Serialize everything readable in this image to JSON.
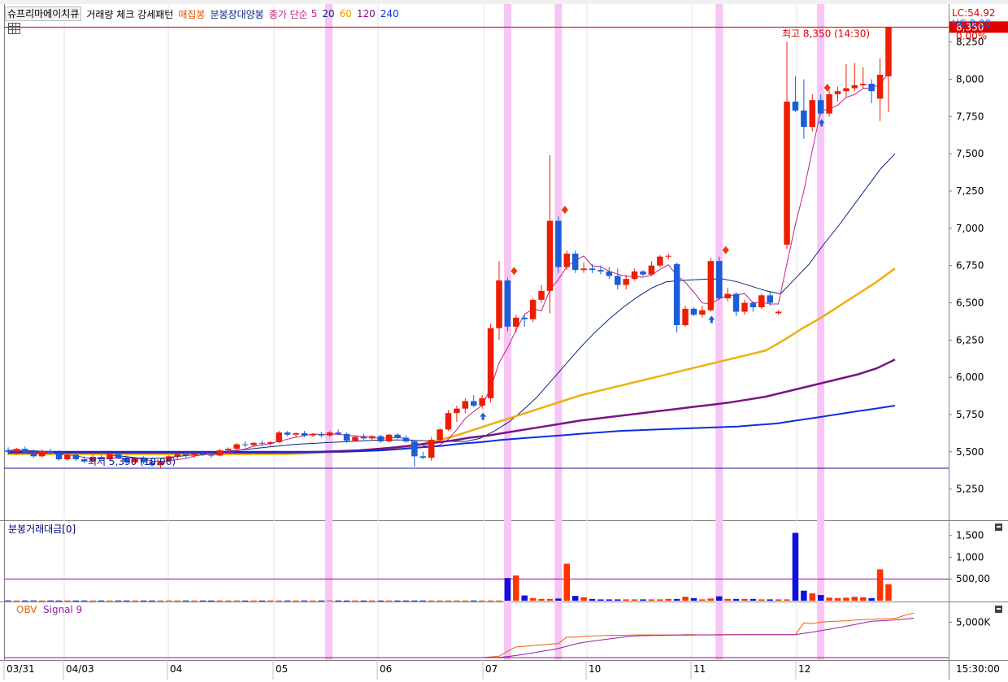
{
  "legend": {
    "title": "슈프리마에이치큐",
    "pattern": "거래량 체크 강세패턴",
    "accum": "매집봉",
    "minute_bull": "분봉장대양봉",
    "ma_label": "종가 단순",
    "ma_periods": [
      "5",
      "20",
      "60",
      "120",
      "240"
    ]
  },
  "header_right": {
    "lc": "LC:54.92",
    "hc": "HC:0.00"
  },
  "price_axis": {
    "ticks": [
      "8,250",
      "8,000",
      "7,750",
      "7,500",
      "7,250",
      "7,000",
      "6,750",
      "6,500",
      "6,250",
      "6,000",
      "5,750",
      "5,500",
      "5,250"
    ]
  },
  "annotations": {
    "high": "최고 8,350 (14:30)",
    "low": "최저 5,390 (10:06)",
    "last_price": "8,350",
    "last_change": "0.00%"
  },
  "volume_panel": {
    "label": "분봉거래대금[0]",
    "ticks": [
      "1,500",
      "1,000",
      "500,00"
    ]
  },
  "obv_panel": {
    "obv": "OBV",
    "signal": "Signal 9",
    "ticks": [
      "5,000K"
    ]
  },
  "x_axis": {
    "labels": [
      "03/31",
      "04/03",
      "04",
      "05",
      "06",
      "07",
      "10",
      "11",
      "12"
    ],
    "end_time": "15:30:00"
  },
  "colors": {
    "up": "#ee1c00",
    "down": "#1a5ed8",
    "ma5": "#c41e8f",
    "ma20": "#0a2680",
    "ma60": "#f0ae0e",
    "ma120": "#7a1484",
    "ma240": "#0a2ee0",
    "highline": "#e00000",
    "lowline": "#1a1a9a",
    "highlight": "#f7c6f5",
    "obv": "#f06000",
    "signal": "#9a1ca8"
  },
  "chart_data": {
    "type": "candlestick",
    "title": "슈프리마에이치큐",
    "ylim": [
      5150,
      8450
    ],
    "high": 8350,
    "low": 5390,
    "candles": [
      {
        "o": 5510,
        "h": 5530,
        "l": 5480,
        "c": 5500
      },
      {
        "o": 5500,
        "h": 5525,
        "l": 5480,
        "c": 5520
      },
      {
        "o": 5520,
        "h": 5535,
        "l": 5490,
        "c": 5495
      },
      {
        "o": 5495,
        "h": 5515,
        "l": 5460,
        "c": 5470
      },
      {
        "o": 5470,
        "h": 5515,
        "l": 5460,
        "c": 5505
      },
      {
        "o": 5505,
        "h": 5520,
        "l": 5485,
        "c": 5490
      },
      {
        "o": 5490,
        "h": 5510,
        "l": 5440,
        "c": 5450
      },
      {
        "o": 5450,
        "h": 5490,
        "l": 5440,
        "c": 5480
      },
      {
        "o": 5480,
        "h": 5495,
        "l": 5440,
        "c": 5450
      },
      {
        "o": 5450,
        "h": 5470,
        "l": 5425,
        "c": 5435
      },
      {
        "o": 5435,
        "h": 5480,
        "l": 5430,
        "c": 5465
      },
      {
        "o": 5465,
        "h": 5480,
        "l": 5440,
        "c": 5450
      },
      {
        "o": 5450,
        "h": 5490,
        "l": 5440,
        "c": 5485
      },
      {
        "o": 5485,
        "h": 5495,
        "l": 5450,
        "c": 5460
      },
      {
        "o": 5460,
        "h": 5475,
        "l": 5420,
        "c": 5430
      },
      {
        "o": 5430,
        "h": 5460,
        "l": 5420,
        "c": 5455
      },
      {
        "o": 5455,
        "h": 5470,
        "l": 5420,
        "c": 5430
      },
      {
        "o": 5430,
        "h": 5445,
        "l": 5400,
        "c": 5410
      },
      {
        "o": 5410,
        "h": 5450,
        "l": 5390,
        "c": 5440
      },
      {
        "o": 5440,
        "h": 5475,
        "l": 5430,
        "c": 5470
      },
      {
        "o": 5470,
        "h": 5490,
        "l": 5450,
        "c": 5485
      },
      {
        "o": 5485,
        "h": 5500,
        "l": 5460,
        "c": 5475
      },
      {
        "o": 5475,
        "h": 5495,
        "l": 5460,
        "c": 5490
      },
      {
        "o": 5490,
        "h": 5505,
        "l": 5470,
        "c": 5480
      },
      {
        "o": 5480,
        "h": 5500,
        "l": 5460,
        "c": 5475
      },
      {
        "o": 5475,
        "h": 5520,
        "l": 5470,
        "c": 5510
      },
      {
        "o": 5510,
        "h": 5530,
        "l": 5490,
        "c": 5520
      },
      {
        "o": 5520,
        "h": 5560,
        "l": 5510,
        "c": 5550
      },
      {
        "o": 5550,
        "h": 5570,
        "l": 5530,
        "c": 5545
      },
      {
        "o": 5545,
        "h": 5565,
        "l": 5535,
        "c": 5560
      },
      {
        "o": 5560,
        "h": 5575,
        "l": 5540,
        "c": 5555
      },
      {
        "o": 5555,
        "h": 5570,
        "l": 5540,
        "c": 5565
      },
      {
        "o": 5565,
        "h": 5640,
        "l": 5560,
        "c": 5630
      },
      {
        "o": 5630,
        "h": 5640,
        "l": 5605,
        "c": 5615
      },
      {
        "o": 5615,
        "h": 5630,
        "l": 5595,
        "c": 5625
      },
      {
        "o": 5625,
        "h": 5640,
        "l": 5600,
        "c": 5610
      },
      {
        "o": 5610,
        "h": 5625,
        "l": 5600,
        "c": 5620
      },
      {
        "o": 5620,
        "h": 5635,
        "l": 5595,
        "c": 5610
      },
      {
        "o": 5610,
        "h": 5640,
        "l": 5600,
        "c": 5630
      },
      {
        "o": 5630,
        "h": 5650,
        "l": 5610,
        "c": 5620
      },
      {
        "o": 5620,
        "h": 5630,
        "l": 5560,
        "c": 5575
      },
      {
        "o": 5575,
        "h": 5610,
        "l": 5570,
        "c": 5600
      },
      {
        "o": 5600,
        "h": 5620,
        "l": 5580,
        "c": 5590
      },
      {
        "o": 5590,
        "h": 5610,
        "l": 5580,
        "c": 5605
      },
      {
        "o": 5605,
        "h": 5615,
        "l": 5560,
        "c": 5570
      },
      {
        "o": 5570,
        "h": 5620,
        "l": 5565,
        "c": 5615
      },
      {
        "o": 5615,
        "h": 5625,
        "l": 5585,
        "c": 5595
      },
      {
        "o": 5595,
        "h": 5610,
        "l": 5560,
        "c": 5570
      },
      {
        "o": 5570,
        "h": 5580,
        "l": 5400,
        "c": 5470
      },
      {
        "o": 5470,
        "h": 5500,
        "l": 5450,
        "c": 5460
      },
      {
        "o": 5460,
        "h": 5600,
        "l": 5440,
        "c": 5580
      },
      {
        "o": 5580,
        "h": 5660,
        "l": 5570,
        "c": 5650
      },
      {
        "o": 5650,
        "h": 5780,
        "l": 5640,
        "c": 5760
      },
      {
        "o": 5760,
        "h": 5810,
        "l": 5700,
        "c": 5790
      },
      {
        "o": 5790,
        "h": 5860,
        "l": 5760,
        "c": 5840
      },
      {
        "o": 5840,
        "h": 5880,
        "l": 5800,
        "c": 5810
      },
      {
        "o": 5810,
        "h": 5880,
        "l": 5790,
        "c": 5860
      },
      {
        "o": 5860,
        "h": 6360,
        "l": 5830,
        "c": 6330
      },
      {
        "o": 6330,
        "h": 6780,
        "l": 6250,
        "c": 6650
      },
      {
        "o": 6650,
        "h": 6670,
        "l": 6310,
        "c": 6340
      },
      {
        "o": 6340,
        "h": 6420,
        "l": 6300,
        "c": 6400
      },
      {
        "o": 6400,
        "h": 6420,
        "l": 6340,
        "c": 6390
      },
      {
        "o": 6390,
        "h": 6530,
        "l": 6370,
        "c": 6520
      },
      {
        "o": 6520,
        "h": 6620,
        "l": 6500,
        "c": 6580
      },
      {
        "o": 6580,
        "h": 7490,
        "l": 6430,
        "c": 7050
      },
      {
        "o": 7050,
        "h": 7080,
        "l": 6700,
        "c": 6740
      },
      {
        "o": 6740,
        "h": 6850,
        "l": 6720,
        "c": 6830
      },
      {
        "o": 6830,
        "h": 6850,
        "l": 6700,
        "c": 6720
      },
      {
        "o": 6720,
        "h": 6770,
        "l": 6700,
        "c": 6730
      },
      {
        "o": 6730,
        "h": 6760,
        "l": 6700,
        "c": 6720
      },
      {
        "o": 6720,
        "h": 6750,
        "l": 6690,
        "c": 6710
      },
      {
        "o": 6710,
        "h": 6740,
        "l": 6660,
        "c": 6680
      },
      {
        "o": 6680,
        "h": 6730,
        "l": 6590,
        "c": 6620
      },
      {
        "o": 6620,
        "h": 6690,
        "l": 6590,
        "c": 6660
      },
      {
        "o": 6660,
        "h": 6730,
        "l": 6650,
        "c": 6710
      },
      {
        "o": 6710,
        "h": 6720,
        "l": 6680,
        "c": 6690
      },
      {
        "o": 6690,
        "h": 6780,
        "l": 6680,
        "c": 6750
      },
      {
        "o": 6750,
        "h": 6820,
        "l": 6740,
        "c": 6810
      },
      {
        "o": 6810,
        "h": 6830,
        "l": 6790,
        "c": 6815
      },
      {
        "o": 6760,
        "h": 6770,
        "l": 6300,
        "c": 6350
      },
      {
        "o": 6350,
        "h": 6480,
        "l": 6340,
        "c": 6460
      },
      {
        "o": 6460,
        "h": 6470,
        "l": 6410,
        "c": 6420
      },
      {
        "o": 6420,
        "h": 6480,
        "l": 6400,
        "c": 6450
      },
      {
        "o": 6450,
        "h": 6800,
        "l": 6440,
        "c": 6780
      },
      {
        "o": 6780,
        "h": 6810,
        "l": 6520,
        "c": 6530
      },
      {
        "o": 6530,
        "h": 6600,
        "l": 6510,
        "c": 6560
      },
      {
        "o": 6560,
        "h": 6570,
        "l": 6410,
        "c": 6440
      },
      {
        "o": 6440,
        "h": 6520,
        "l": 6420,
        "c": 6500
      },
      {
        "o": 6500,
        "h": 6510,
        "l": 6440,
        "c": 6470
      },
      {
        "o": 6470,
        "h": 6560,
        "l": 6460,
        "c": 6550
      },
      {
        "o": 6550,
        "h": 6580,
        "l": 6480,
        "c": 6500
      },
      {
        "o": 6430,
        "h": 6450,
        "l": 6420,
        "c": 6440
      },
      {
        "o": 6890,
        "h": 8250,
        "l": 6860,
        "c": 7850
      },
      {
        "o": 7850,
        "h": 8020,
        "l": 7780,
        "c": 7790
      },
      {
        "o": 7790,
        "h": 8000,
        "l": 7600,
        "c": 7680
      },
      {
        "o": 7680,
        "h": 7900,
        "l": 7650,
        "c": 7860
      },
      {
        "o": 7860,
        "h": 7900,
        "l": 7760,
        "c": 7770
      },
      {
        "o": 7770,
        "h": 7930,
        "l": 7750,
        "c": 7900
      },
      {
        "o": 7900,
        "h": 7950,
        "l": 7850,
        "c": 7920
      },
      {
        "o": 7920,
        "h": 8100,
        "l": 7880,
        "c": 7940
      },
      {
        "o": 7940,
        "h": 8110,
        "l": 7920,
        "c": 7960
      },
      {
        "o": 7960,
        "h": 8080,
        "l": 7940,
        "c": 7970
      },
      {
        "o": 7970,
        "h": 8000,
        "l": 7840,
        "c": 7920
      },
      {
        "o": 7870,
        "h": 8140,
        "l": 7720,
        "c": 8030
      },
      {
        "o": 8020,
        "h": 8350,
        "l": 7780,
        "c": 8350
      }
    ],
    "pattern_markers": [
      59,
      65,
      84,
      96
    ],
    "bull_markers": [
      59,
      65,
      84,
      96
    ],
    "minute_bull_markers": [
      56,
      83,
      96
    ],
    "ma": [
      {
        "period": 20,
        "values": [
          5510,
          5510,
          5505,
          5500,
          5495,
          5490,
          5485,
          5480,
          5470,
          5460,
          5455,
          5460,
          5470,
          5480,
          5490,
          5500,
          5510,
          5520,
          5530,
          5540,
          5550,
          5555,
          5560,
          5565,
          5570,
          5575,
          5580,
          5580,
          5580,
          5575,
          5570,
          5570,
          5570,
          5590,
          5640,
          5700,
          5780,
          5870,
          5980,
          6090,
          6200,
          6300,
          6390,
          6470,
          6540,
          6600,
          6640,
          6650,
          6655,
          6660,
          6660,
          6640,
          6610,
          6580,
          6560,
          6660,
          6760,
          6890,
          7010,
          7140,
          7270,
          7400,
          7500
        ]
      },
      {
        "period": 60,
        "values": [
          5485,
          5485,
          5485,
          5485,
          5485,
          5485,
          5485,
          5485,
          5485,
          5485,
          5485,
          5485,
          5485,
          5485,
          5485,
          5485,
          5490,
          5495,
          5500,
          5505,
          5510,
          5520,
          5540,
          5570,
          5600,
          5640,
          5680,
          5720,
          5760,
          5800,
          5840,
          5880,
          5910,
          5940,
          5970,
          6000,
          6030,
          6060,
          6090,
          6120,
          6150,
          6180,
          6250,
          6330,
          6400,
          6480,
          6560,
          6640,
          6730
        ]
      },
      {
        "period": 120,
        "values": [
          5495,
          5495,
          5495,
          5495,
          5495,
          5495,
          5495,
          5495,
          5495,
          5495,
          5495,
          5495,
          5495,
          5495,
          5495,
          5495,
          5497,
          5500,
          5505,
          5510,
          5520,
          5530,
          5545,
          5560,
          5575,
          5595,
          5610,
          5630,
          5650,
          5670,
          5690,
          5710,
          5725,
          5740,
          5755,
          5770,
          5785,
          5800,
          5815,
          5830,
          5850,
          5870,
          5900,
          5930,
          5960,
          5990,
          6020,
          6060,
          6120
        ]
      },
      {
        "period": 240,
        "values": [
          5500,
          5500,
          5500,
          5500,
          5500,
          5500,
          5500,
          5500,
          5500,
          5500,
          5500,
          5500,
          5500,
          5500,
          5500,
          5500,
          5500,
          5500,
          5505,
          5510,
          5520,
          5530,
          5540,
          5555,
          5565,
          5580,
          5590,
          5600,
          5610,
          5620,
          5630,
          5640,
          5645,
          5650,
          5655,
          5660,
          5665,
          5670,
          5680,
          5690,
          5710,
          5730,
          5750,
          5770,
          5790,
          5810
        ]
      }
    ],
    "volume": [
      8,
      5,
      6,
      7,
      5,
      6,
      5,
      6,
      5,
      6,
      5,
      6,
      5,
      6,
      5,
      6,
      5,
      6,
      5,
      6,
      5,
      6,
      5,
      6,
      5,
      6,
      5,
      6,
      5,
      6,
      5,
      6,
      5,
      6,
      5,
      6,
      5,
      6,
      5,
      6,
      5,
      6,
      5,
      6,
      5,
      6,
      5,
      6,
      5,
      6,
      5,
      6,
      5,
      6,
      5,
      6,
      5,
      6,
      5,
      520,
      580,
      120,
      60,
      40,
      40,
      50,
      850,
      110,
      80,
      40,
      30,
      30,
      30,
      30,
      30,
      30,
      30,
      30,
      40,
      40,
      90,
      60,
      30,
      50,
      100,
      40,
      40,
      40,
      40,
      30,
      30,
      30,
      30,
      1560,
      230,
      170,
      130,
      70,
      60,
      70,
      90,
      80,
      60,
      720,
      380,
      0
    ],
    "obv": [
      0,
      0,
      0,
      0,
      0,
      0,
      0,
      0,
      0,
      0,
      0,
      0,
      0,
      0,
      0,
      0,
      0,
      0,
      0,
      0,
      0,
      0,
      0,
      0,
      0,
      0,
      0,
      0,
      0,
      0,
      0,
      0,
      0,
      0,
      0,
      0,
      0,
      0,
      0,
      0,
      0,
      0,
      0,
      0,
      0,
      0,
      0,
      0,
      0,
      0,
      0,
      0,
      0,
      0,
      0,
      0,
      0,
      100,
      200,
      900,
      1500,
      1600,
      1700,
      1800,
      1900,
      2000,
      2900,
      2900,
      3000,
      3050,
      3100,
      3150,
      3150,
      3150,
      3200,
      3200,
      3200,
      3200,
      3200,
      3200,
      3250,
      3250,
      3200,
      3200,
      3250,
      3250,
      3250,
      3250,
      3250,
      3250,
      3250,
      3250,
      3250,
      3250,
      4900,
      4800,
      5000,
      5100,
      5150,
      5200,
      5300,
      5350,
      5400,
      5450,
      5500,
      5600,
      6000,
      6300
    ]
  }
}
